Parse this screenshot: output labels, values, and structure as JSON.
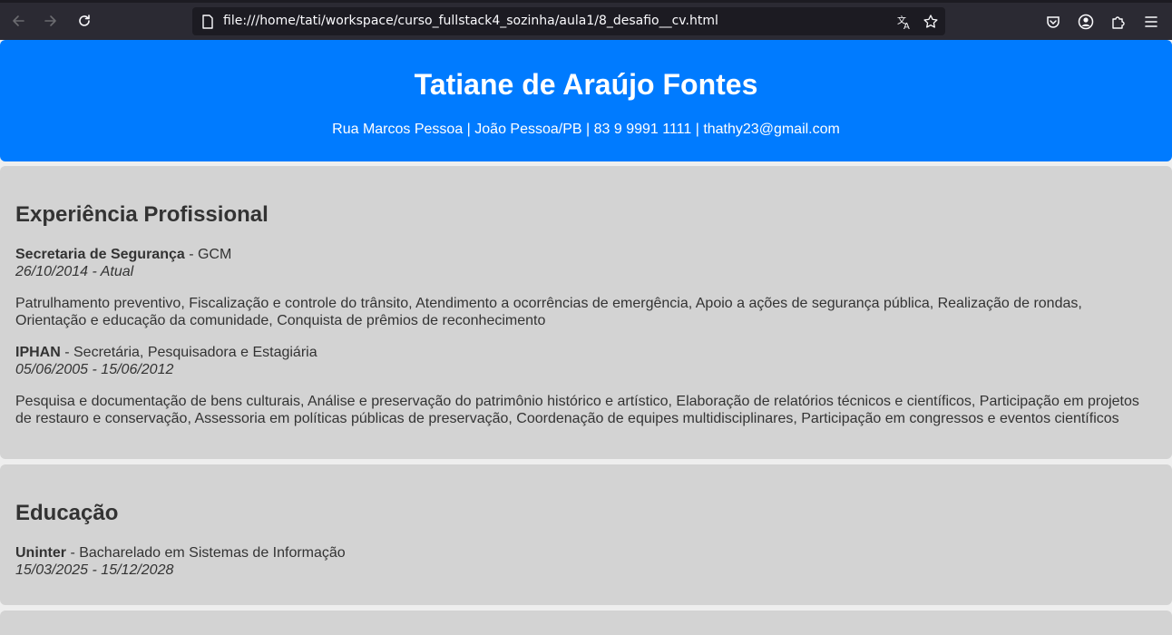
{
  "browser": {
    "url": "file:///home/tati/workspace/curso_fullstack4_sozinha/aula1/8_desafio__cv.html"
  },
  "header": {
    "name": "Tatiane de Araújo Fontes",
    "contact": "Rua Marcos Pessoa | João Pessoa/PB | 83 9 9991 1111 | thathy23@gmail.com"
  },
  "experience": {
    "title": "Experiência Profissional",
    "jobs": [
      {
        "org": "Secretaria de Segurança",
        "role": " - GCM",
        "period": "26/10/2014 - Atual",
        "description": "Patrulhamento preventivo, Fiscalização e controle do trânsito, Atendimento a ocorrências de emergência, Apoio a ações de segurança pública, Realização de rondas, Orientação e educação da comunidade, Conquista de prêmios de reconhecimento"
      },
      {
        "org": "IPHAN",
        "role": " - Secretária, Pesquisadora e Estagiária",
        "period": "05/06/2005 - 15/06/2012",
        "description": "Pesquisa e documentação de bens culturais, Análise e preservação do patrimônio histórico e artístico, Elaboração de relatórios técnicos e científicos, Participação em projetos de restauro e conservação, Assessoria em políticas públicas de preservação, Coordenação de equipes multidisciplinares, Participação em congressos e eventos científicos"
      }
    ]
  },
  "education": {
    "title": "Educação",
    "items": [
      {
        "org": "Uninter",
        "course": " - Bacharelado em Sistemas de Informação",
        "period": "15/03/2025 - 15/12/2028"
      }
    ]
  },
  "icons": {
    "back": "arrow-left-icon",
    "forward": "arrow-right-icon",
    "reload": "reload-icon",
    "page": "page-icon",
    "translate": "translate-icon",
    "bookmark": "star-icon",
    "pocket": "pocket-icon",
    "account": "account-icon",
    "extensions": "puzzle-icon",
    "menu": "hamburger-menu-icon"
  },
  "colors": {
    "header_bg": "#007bff",
    "section_bg": "#d3d3d3",
    "page_bg": "#eeeeee",
    "toolbar_bg": "#2b2a33"
  }
}
